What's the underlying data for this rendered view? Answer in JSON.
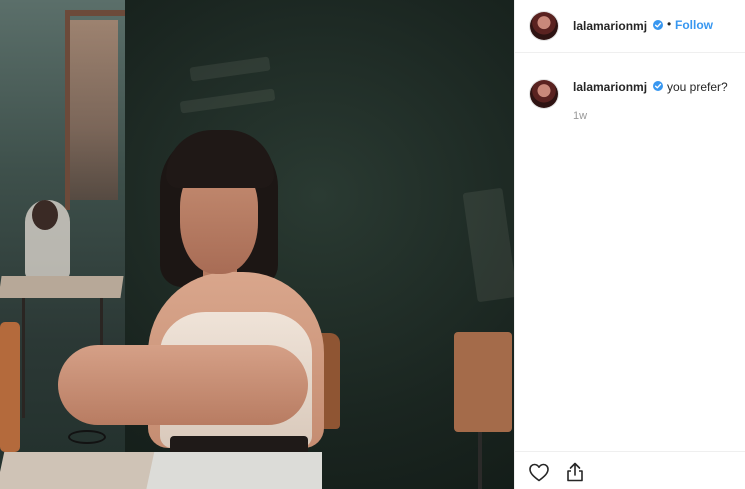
{
  "post": {
    "image": {
      "alt_subject": "photo-post"
    },
    "header": {
      "username": "lalamarionmj",
      "separator": "•",
      "follow_label": "Follow"
    },
    "caption": {
      "username": "lalamarionmj",
      "text": "you prefer?",
      "time": "1w"
    },
    "actions": {
      "like_icon": "heart-icon",
      "share_icon": "share-icon"
    },
    "colors": {
      "link_blue": "#3897f0",
      "verified_blue": "#3897f0",
      "text_primary": "#262626",
      "text_muted": "#999999",
      "divider": "#efefef"
    }
  }
}
